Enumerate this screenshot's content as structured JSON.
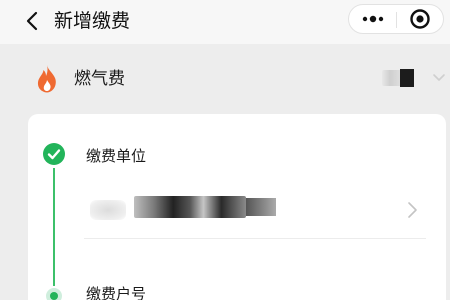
{
  "nav": {
    "title": "新增缴费",
    "back_icon": "chevron-left-icon",
    "more_icon": "more-dots-icon",
    "close_icon": "target-close-icon"
  },
  "fee_type": {
    "label": "燃气费",
    "icon": "flame-icon",
    "icon_color": "#ef6a32",
    "dropdown_icon": "chevron-down-icon"
  },
  "steps": [
    {
      "label": "缴费单位",
      "status": "done",
      "icon": "check-circle-icon",
      "color": "#22b45a"
    },
    {
      "label": "缴费户号",
      "status": "current",
      "icon": "dot-icon",
      "color": "#22b45a"
    }
  ],
  "unit_field": {
    "value_redacted": true,
    "chevron_icon": "chevron-right-icon"
  },
  "colors": {
    "accent": "#22b45a",
    "background": "#ededed",
    "card": "#ffffff"
  }
}
